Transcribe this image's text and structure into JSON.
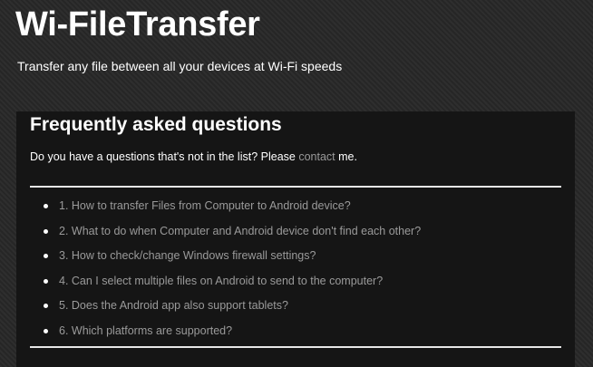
{
  "header": {
    "title": "Wi-FileTransfer",
    "tagline": "Transfer any file between all your devices at Wi-Fi speeds"
  },
  "faq": {
    "heading": "Frequently asked questions",
    "intro_before": "Do you have a questions that's not in the list? Please ",
    "contact_label": "contact",
    "intro_after": " me.",
    "questions": [
      "1. How to transfer Files from Computer to Android device?",
      "2. What to do when Computer and Android device don't find each other?",
      "3. How to check/change Windows firewall settings?",
      "4. Can I select multiple files on Android to send to the computer?",
      "5. Does the Android app also support tablets?",
      "6. Which platforms are supported?"
    ]
  },
  "colors": {
    "link": "#9a9a9a",
    "panel": "#151515",
    "text": "#ffffff"
  }
}
